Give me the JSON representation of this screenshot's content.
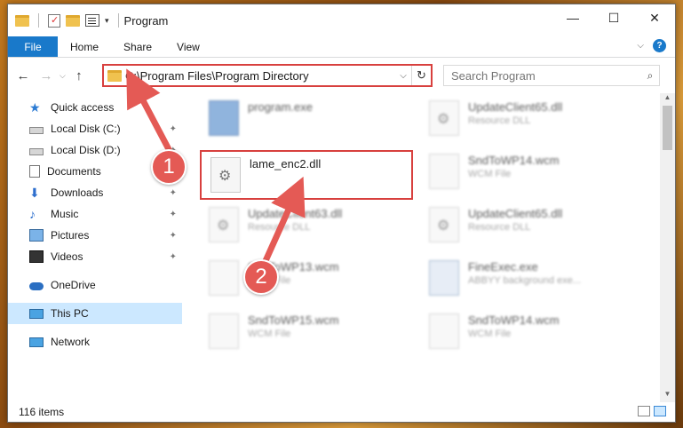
{
  "window": {
    "title": "Program",
    "controls": {
      "minimize": "—",
      "maximize": "☐",
      "close": "✕"
    },
    "quick_access_dropdown": "▾"
  },
  "ribbon": {
    "tabs": [
      "File",
      "Home",
      "Share",
      "View"
    ],
    "expand_icon": "chevron-down",
    "help_icon": "?"
  },
  "address_bar": {
    "path": "C:\\Program Files\\Program Directory",
    "dropdown": "⌵",
    "refresh": "↻"
  },
  "nav_buttons": {
    "back": "←",
    "forward": "→",
    "dropdown": "⌵",
    "up": "↑"
  },
  "search": {
    "placeholder": "Search Program",
    "icon": "⌕"
  },
  "sidebar": {
    "items": [
      {
        "label": "Quick access",
        "icon": "star-icon",
        "pinned": false
      },
      {
        "label": "Local Disk (C:)",
        "icon": "disk-icon",
        "pinned": true
      },
      {
        "label": "Local Disk (D:)",
        "icon": "disk-icon",
        "pinned": true
      },
      {
        "label": "Documents",
        "icon": "documents-icon",
        "pinned": true
      },
      {
        "label": "Downloads",
        "icon": "download-icon",
        "pinned": true
      },
      {
        "label": "Music",
        "icon": "music-icon",
        "pinned": true
      },
      {
        "label": "Pictures",
        "icon": "pictures-icon",
        "pinned": true
      },
      {
        "label": "Videos",
        "icon": "videos-icon",
        "pinned": true
      },
      {
        "label": "OneDrive",
        "icon": "cloud-icon",
        "pinned": false
      },
      {
        "label": "This PC",
        "icon": "pc-icon",
        "pinned": false,
        "selected": true
      },
      {
        "label": "Network",
        "icon": "network-icon",
        "pinned": false
      }
    ],
    "pin_glyph": "📌"
  },
  "files": [
    {
      "name": "program.exe",
      "type": "",
      "blurred": true
    },
    {
      "name": "UpdateClient65.dll",
      "type": "Resource DLL",
      "blurred": true
    },
    {
      "name": "lame_enc2.dll",
      "type": "",
      "blurred": false,
      "highlighted": true
    },
    {
      "name": "SndToWP14.wcm",
      "type": "WCM File",
      "blurred": true
    },
    {
      "name": "UpdateClient63.dll",
      "type": "Resource DLL",
      "blurred": true
    },
    {
      "name": "UpdateClient65.dll",
      "type": "Resource DLL",
      "blurred": true
    },
    {
      "name": "SndToWP13.wcm",
      "type": "WCM File",
      "blurred": true
    },
    {
      "name": "FineExec.exe",
      "type": "ABBYY background exe...",
      "blurred": true
    },
    {
      "name": "SndToWP15.wcm",
      "type": "WCM File",
      "blurred": true
    },
    {
      "name": "SndToWP14.wcm",
      "type": "WCM File",
      "blurred": true
    }
  ],
  "status": {
    "item_count": "116 items"
  },
  "annotations": {
    "step1": "1",
    "step2": "2",
    "accent": "#e45a55"
  }
}
